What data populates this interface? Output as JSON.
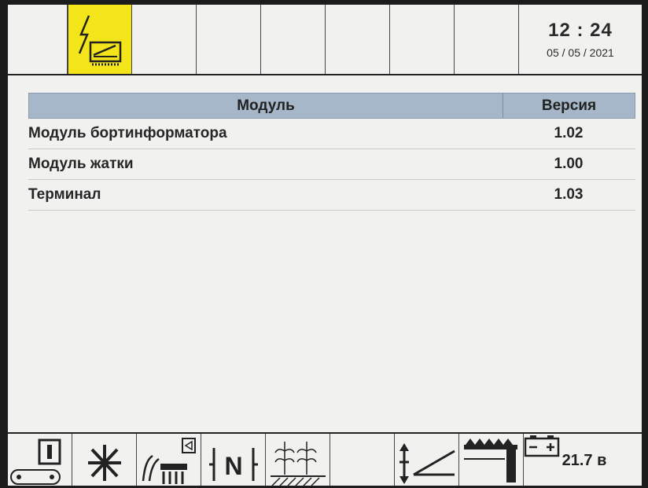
{
  "header": {
    "time": "12 : 24",
    "date": "05 / 05 / 2021",
    "tabs": [
      {
        "icon": "power-header-icon",
        "active": true
      },
      {
        "icon": "empty",
        "active": false
      },
      {
        "icon": "empty",
        "active": false
      },
      {
        "icon": "empty",
        "active": false
      },
      {
        "icon": "empty",
        "active": false
      },
      {
        "icon": "empty",
        "active": false
      },
      {
        "icon": "empty",
        "active": false
      }
    ],
    "active_color": "#f4e51a"
  },
  "table": {
    "columns": [
      "Модуль",
      "Версия"
    ],
    "header_color": "#a6b7ca",
    "rows": [
      {
        "module": "Модуль бортинформатора",
        "version": "1.02"
      },
      {
        "module": "Модуль жатки",
        "version": "1.00"
      },
      {
        "module": "Терминал",
        "version": "1.03"
      }
    ]
  },
  "footer": {
    "buttons": [
      {
        "icon": "conveyor-icon"
      },
      {
        "icon": "fan-icon"
      },
      {
        "icon": "grain-tank-icon"
      },
      {
        "icon": "neutral-gear-icon"
      },
      {
        "icon": "crop-field-icon"
      },
      {
        "icon": "empty"
      },
      {
        "icon": "header-height-icon"
      },
      {
        "icon": "reel-icon"
      }
    ],
    "battery_voltage": "21.7 в",
    "battery_icon": "battery-icon"
  }
}
